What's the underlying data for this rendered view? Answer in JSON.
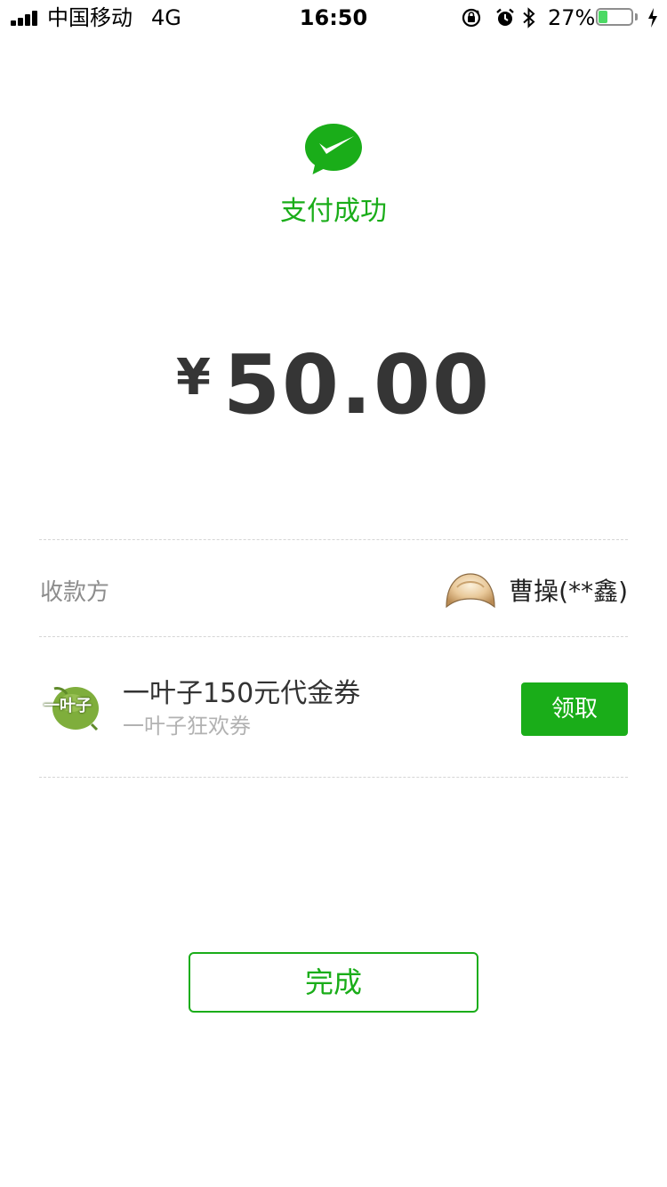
{
  "status_bar": {
    "carrier": "中国移动",
    "network": "4G",
    "time": "16:50",
    "battery_percent": "27%",
    "battery_level": 0.27,
    "icons": [
      "signal-icon",
      "rotation-lock-icon",
      "alarm-icon",
      "bluetooth-icon",
      "battery-icon",
      "charging-icon"
    ]
  },
  "result": {
    "icon": "wechat-pay-check-icon",
    "title": "支付成功",
    "currency": "¥",
    "amount": "50.00"
  },
  "payee": {
    "label": "收款方",
    "name": "曹操(**鑫)"
  },
  "coupon": {
    "title": "一叶子150元代金券",
    "subtitle": "一叶子狂欢券",
    "logo_text": "一叶子",
    "claim_label": "领取"
  },
  "footer": {
    "done_label": "完成"
  },
  "colors": {
    "accent": "#1aad19",
    "amount_text": "#353535",
    "muted_text": "#8d8d8d",
    "battery_fill": "#4cd964"
  }
}
